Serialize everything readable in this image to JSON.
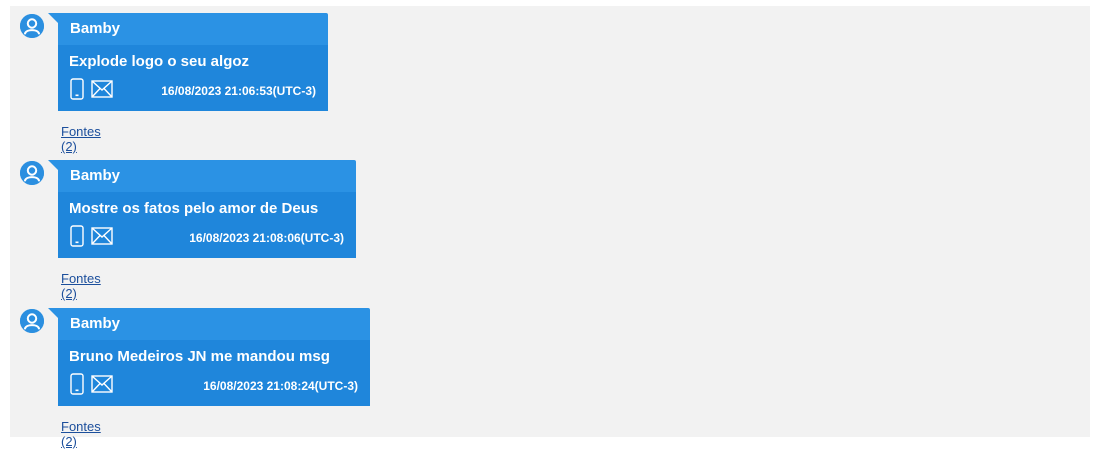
{
  "messages": [
    {
      "sender": "Bamby",
      "text": "Explode logo o seu algoz",
      "timestamp": "16/08/2023 21:06:53(UTC-3)",
      "sources_label": "Fontes (2)"
    },
    {
      "sender": "Bamby",
      "text": "Mostre os fatos pelo amor de Deus",
      "timestamp": "16/08/2023 21:08:06(UTC-3)",
      "sources_label": "Fontes (2)"
    },
    {
      "sender": "Bamby",
      "text": "Bruno Medeiros JN me mandou msg",
      "timestamp": "16/08/2023 21:08:24(UTC-3)",
      "sources_label": "Fontes (2)"
    }
  ],
  "icons": {
    "avatar": "user-avatar-icon",
    "device": "phone-icon",
    "envelope": "envelope-icon"
  },
  "colors": {
    "bubble_header": "#2b92e4",
    "bubble_body": "#1f86db",
    "link": "#1c4f9c",
    "background": "#f2f2f2"
  }
}
